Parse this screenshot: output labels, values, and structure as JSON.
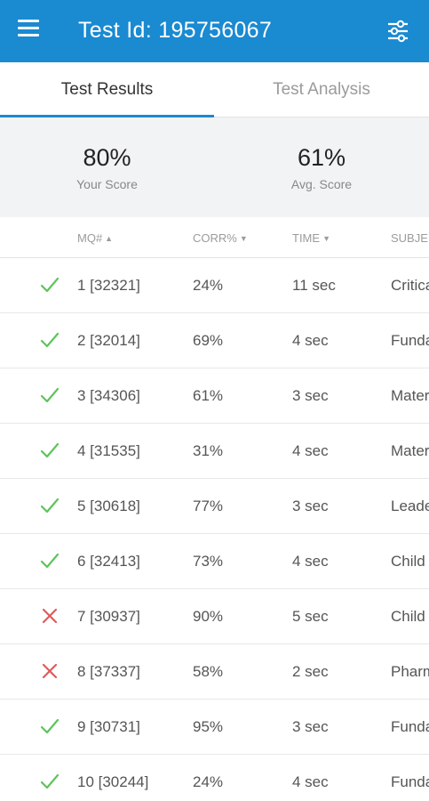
{
  "appbar": {
    "title": "Test Id: 195756067",
    "menu_icon": "hamburger-menu-icon",
    "filter_icon": "sliders-filter-icon",
    "color": "#1a8ad1"
  },
  "tabs": [
    {
      "label": "Test Results",
      "active": true
    },
    {
      "label": "Test Analysis",
      "active": false
    }
  ],
  "scores": {
    "your_score": {
      "value": "80%",
      "label": "Your Score"
    },
    "avg_score": {
      "value": "61%",
      "label": "Avg. Score"
    }
  },
  "table": {
    "headers": {
      "mq": "MQ#",
      "corr": "CORR%",
      "time": "TIME",
      "subject": "SUBJE"
    },
    "rows": [
      {
        "correct": true,
        "mq": "1 [32321]",
        "corr": "24%",
        "time": "11 sec",
        "subject": "Critica"
      },
      {
        "correct": true,
        "mq": "2 [32014]",
        "corr": "69%",
        "time": "4 sec",
        "subject": "Funda"
      },
      {
        "correct": true,
        "mq": "3 [34306]",
        "corr": "61%",
        "time": "3 sec",
        "subject": "Mater"
      },
      {
        "correct": true,
        "mq": "4 [31535]",
        "corr": "31%",
        "time": "4 sec",
        "subject": "Mater"
      },
      {
        "correct": true,
        "mq": "5 [30618]",
        "corr": "77%",
        "time": "3 sec",
        "subject": "Leade"
      },
      {
        "correct": true,
        "mq": "6 [32413]",
        "corr": "73%",
        "time": "4 sec",
        "subject": "Child"
      },
      {
        "correct": false,
        "mq": "7 [30937]",
        "corr": "90%",
        "time": "5 sec",
        "subject": "Child"
      },
      {
        "correct": false,
        "mq": "8 [37337]",
        "corr": "58%",
        "time": "2 sec",
        "subject": "Pharm"
      },
      {
        "correct": true,
        "mq": "9 [30731]",
        "corr": "95%",
        "time": "3 sec",
        "subject": "Funda"
      },
      {
        "correct": true,
        "mq": "10 [30244]",
        "corr": "24%",
        "time": "4 sec",
        "subject": "Funda"
      }
    ]
  },
  "colors": {
    "correct": "#5cc45c",
    "incorrect": "#e05a5a"
  }
}
